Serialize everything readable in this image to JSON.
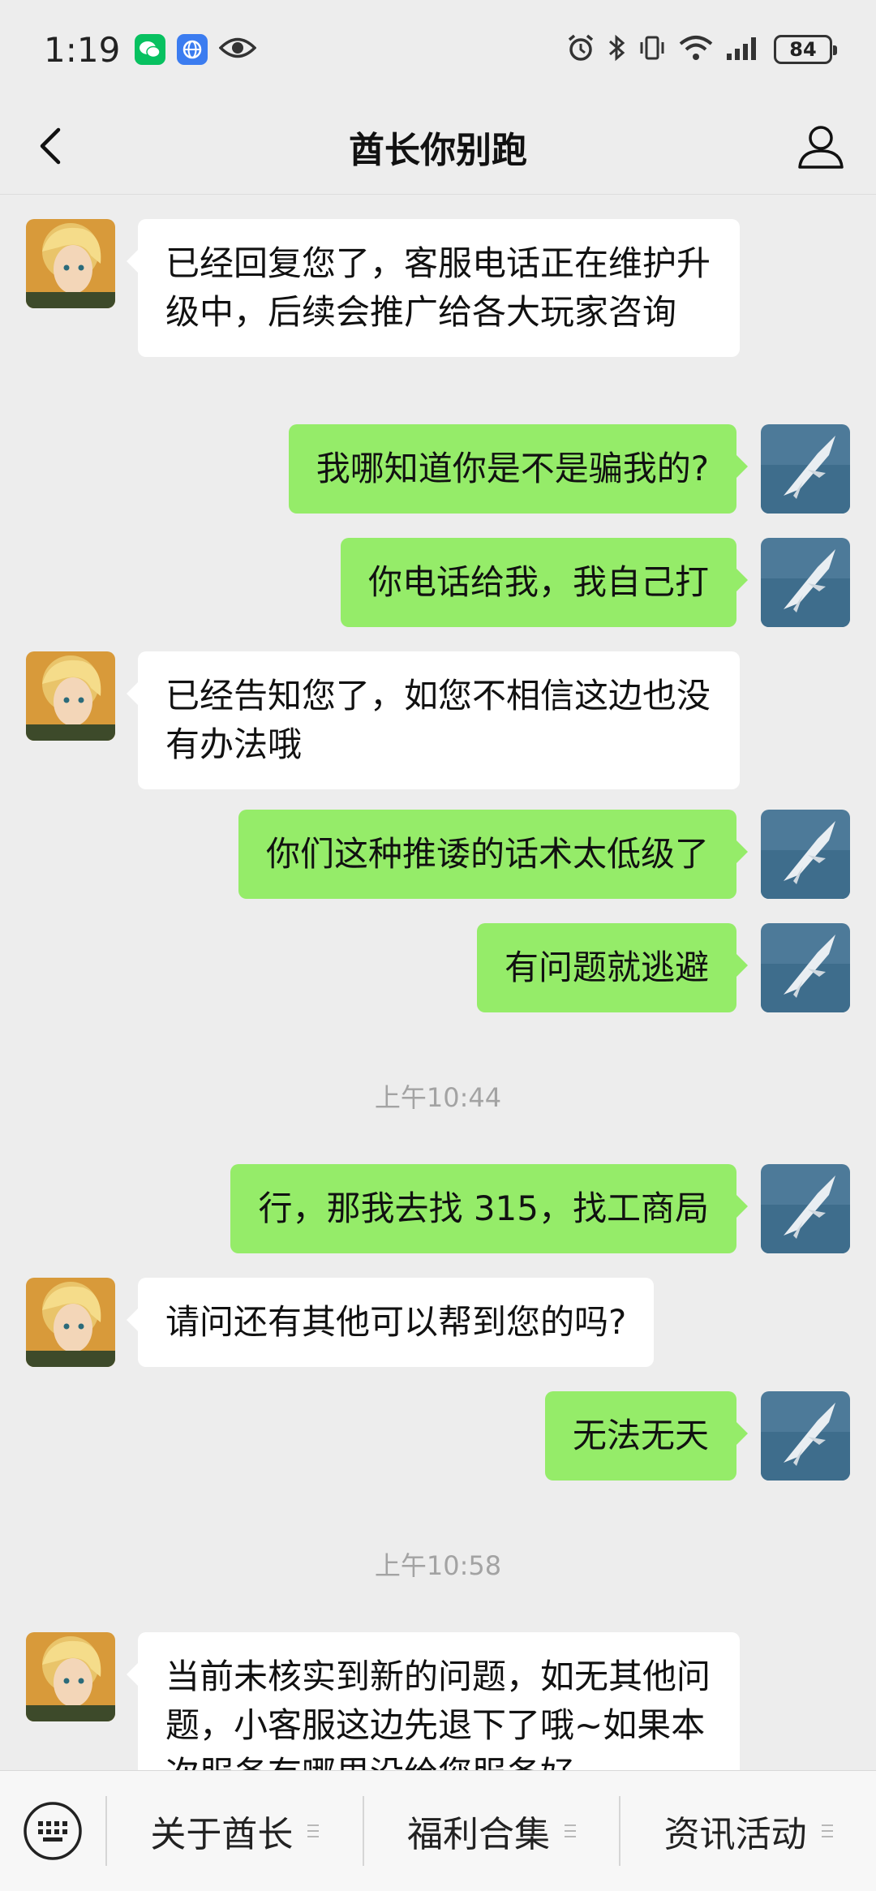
{
  "status_bar": {
    "time": "1:19",
    "battery": "84",
    "colors": {
      "wechat": "#07c160",
      "browser": "#3b7cf0"
    }
  },
  "header": {
    "title": "酋长你别跑"
  },
  "messages": [
    {
      "side": "left",
      "text": "已经回复您了，客服电话正在维护升级中，后续会推广给各大玩家咨询"
    },
    {
      "side": "right",
      "text": "我哪知道你是不是骗我的?"
    },
    {
      "side": "right",
      "text": "你电话给我，我自己打"
    },
    {
      "side": "left",
      "text": "已经告知您了，如您不相信这边也没有办法哦"
    },
    {
      "side": "right",
      "text": "你们这种推诿的话术太低级了"
    },
    {
      "side": "right",
      "text": "有问题就逃避"
    },
    {
      "timestamp": "上午10:44"
    },
    {
      "side": "right",
      "text": "行，那我去找 315，找工商局"
    },
    {
      "side": "left",
      "text": "请问还有其他可以帮到您的吗?"
    },
    {
      "side": "right",
      "text": "无法无天"
    },
    {
      "timestamp": "上午10:58"
    },
    {
      "side": "left",
      "text": "当前未核实到新的问题，如无其他问题，小客服这边先退下了哦~如果本次服务有哪里没给您服务好"
    }
  ],
  "bottom_menu": {
    "items": [
      "关于酋长",
      "福利合集",
      "资讯活动"
    ]
  },
  "colors": {
    "sent_bubble": "#95ec69",
    "received_bubble": "#ffffff",
    "background": "#ededed"
  }
}
